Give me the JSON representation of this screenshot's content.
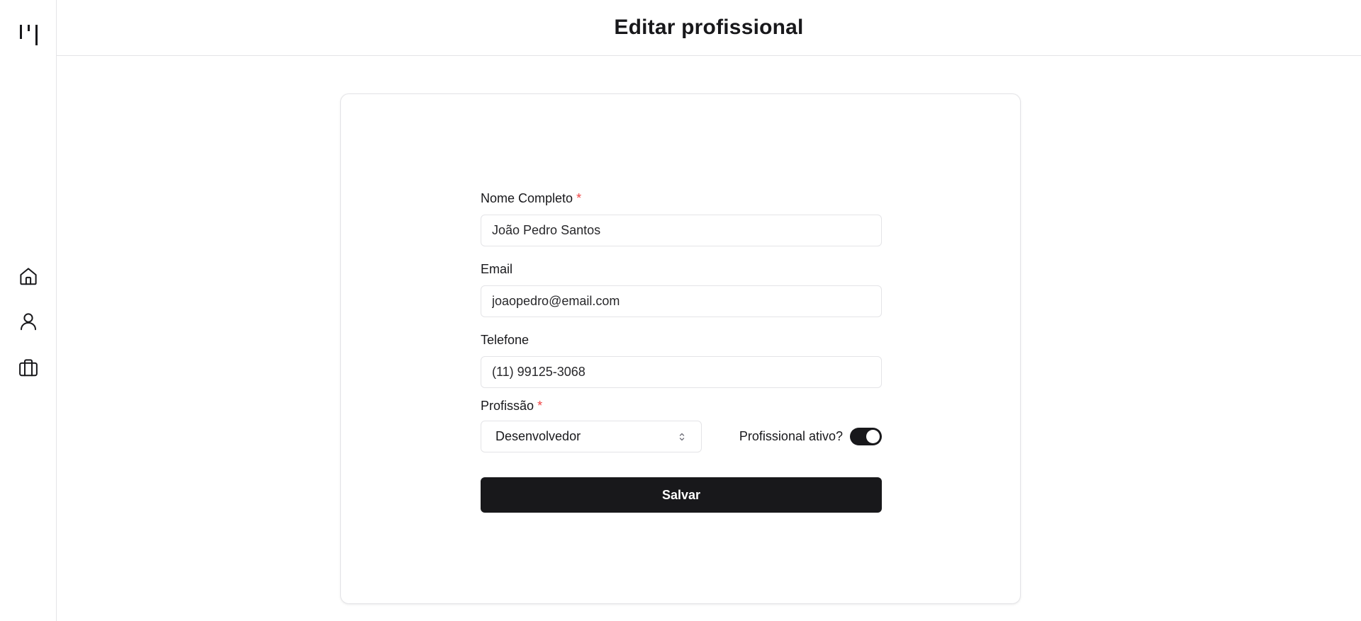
{
  "header": {
    "title": "Editar profissional"
  },
  "sidebar": {
    "items": [
      {
        "icon": "home-icon",
        "label": ""
      },
      {
        "icon": "user-icon",
        "label": ""
      },
      {
        "icon": "briefcase-icon",
        "label": ""
      }
    ]
  },
  "form": {
    "full_name": {
      "label": "Nome Completo",
      "required_mark": "*",
      "value": "João Pedro Santos"
    },
    "email": {
      "label": "Email",
      "value": "joaopedro@email.com"
    },
    "phone": {
      "label": "Telefone",
      "value": "(11) 99125-3068"
    },
    "profession": {
      "label": "Profissão",
      "required_mark": "*",
      "selected": "Desenvolvedor"
    },
    "active_toggle": {
      "label": "Profissional ativo?",
      "checked": true
    },
    "save_label": "Salvar"
  },
  "colors": {
    "primary": "#18181b",
    "required": "#ef4444",
    "border": "#e4e4e7"
  }
}
